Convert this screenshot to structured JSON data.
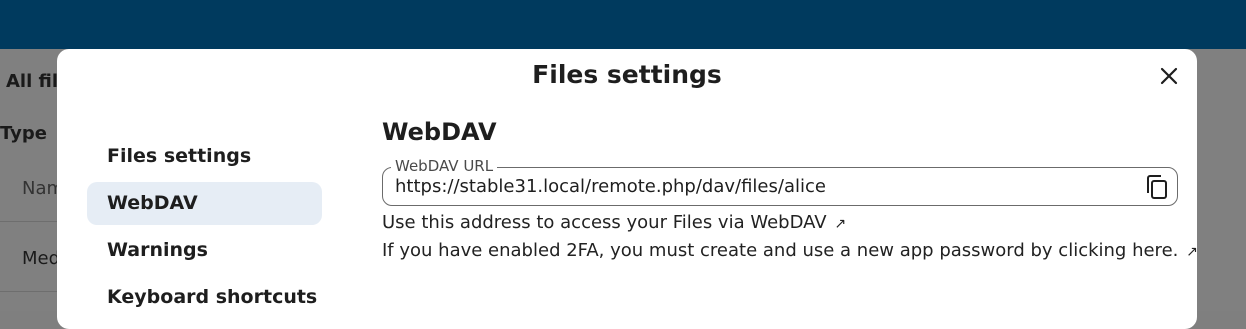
{
  "background": {
    "title": "All fil",
    "type_label": "Type",
    "name_header": "Nam",
    "row_1": "Med"
  },
  "modal": {
    "title": "Files settings",
    "nav": [
      {
        "label": "Files settings"
      },
      {
        "label": "WebDAV"
      },
      {
        "label": "Warnings"
      },
      {
        "label": "Keyboard shortcuts"
      }
    ],
    "active_nav": "WebDAV",
    "section_title": "WebDAV",
    "url_field": {
      "label": "WebDAV URL",
      "value": "https://stable31.local/remote.php/dav/files/alice"
    },
    "help_1": "Use this address to access your Files via WebDAV",
    "help_2": "If you have enabled 2FA, you must create and use a new app password by clicking here.",
    "external_arrow": "↗"
  },
  "colors": {
    "header": "#003a5e",
    "active_nav_bg": "#e6edf5"
  },
  "icons": [
    "close-icon",
    "copy-icon",
    "external-link-icon"
  ]
}
